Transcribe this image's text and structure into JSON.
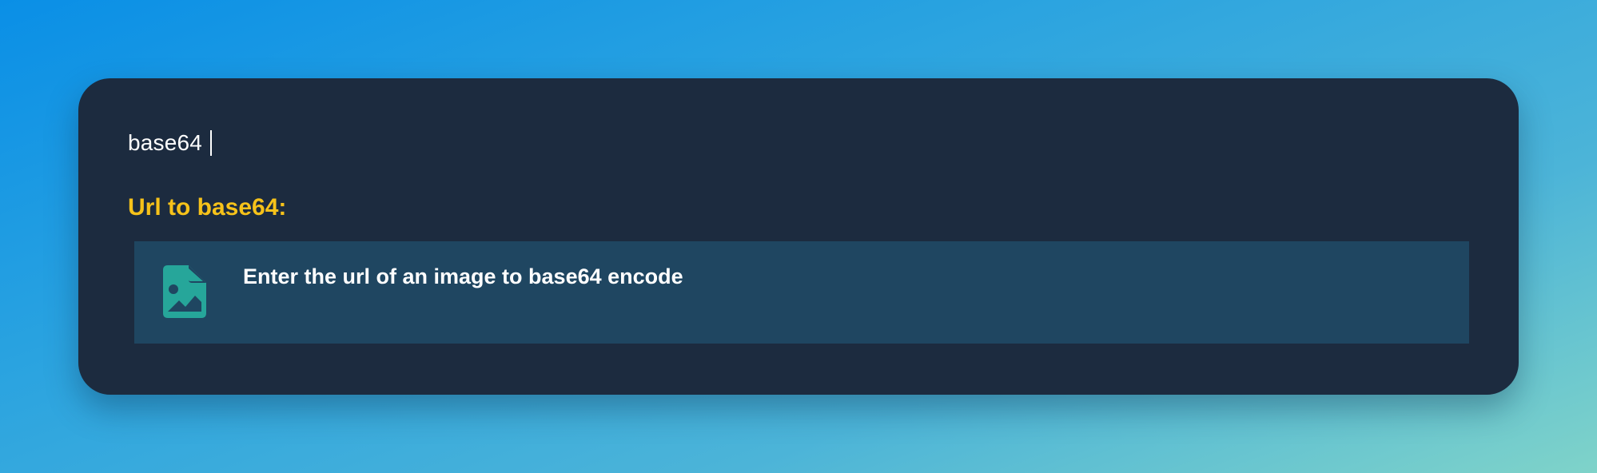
{
  "search": {
    "query": "base64"
  },
  "section": {
    "title": "Url to base64:"
  },
  "results": [
    {
      "icon": "image-file-icon",
      "text": "Enter the url of an image to base64 encode"
    }
  ],
  "colors": {
    "panel": "#1c2b3f",
    "highlight_row": "#1f4661",
    "section_title": "#f6c21a",
    "icon": "#26a69a"
  }
}
